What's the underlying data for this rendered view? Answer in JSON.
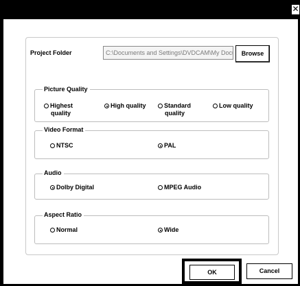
{
  "window": {
    "close_glyph": "✕"
  },
  "project_folder": {
    "label": "Project Folder",
    "path_value": "C:\\Documents and Settings\\DVDCAM\\My Documents",
    "browse_label": "Browse"
  },
  "picture_quality": {
    "title": "Picture Quality",
    "options": [
      {
        "line1": "Highest",
        "line2": "quality",
        "selected": false
      },
      {
        "line1": "High quality",
        "line2": "",
        "selected": true
      },
      {
        "line1": "Standard",
        "line2": "quality",
        "selected": false
      },
      {
        "line1": "Low quality",
        "line2": "",
        "selected": false
      }
    ]
  },
  "video_format": {
    "title": "Video Format",
    "options": [
      {
        "label": "NTSC",
        "selected": false
      },
      {
        "label": "PAL",
        "selected": true
      }
    ]
  },
  "audio": {
    "title": "Audio",
    "options": [
      {
        "label": "Dolby Digital",
        "selected": true
      },
      {
        "label": "MPEG Audio",
        "selected": false
      }
    ]
  },
  "aspect_ratio": {
    "title": "Aspect Ratio",
    "options": [
      {
        "label": "Normal",
        "selected": false
      },
      {
        "label": "Wide",
        "selected": true
      }
    ]
  },
  "buttons": {
    "ok_label": "OK",
    "cancel_label": "Cancel"
  },
  "colors": {
    "title_bar": "#000000",
    "background": "#ffffff",
    "group_border": "#bcbcbc",
    "disabled_text": "#7a7a7a"
  }
}
